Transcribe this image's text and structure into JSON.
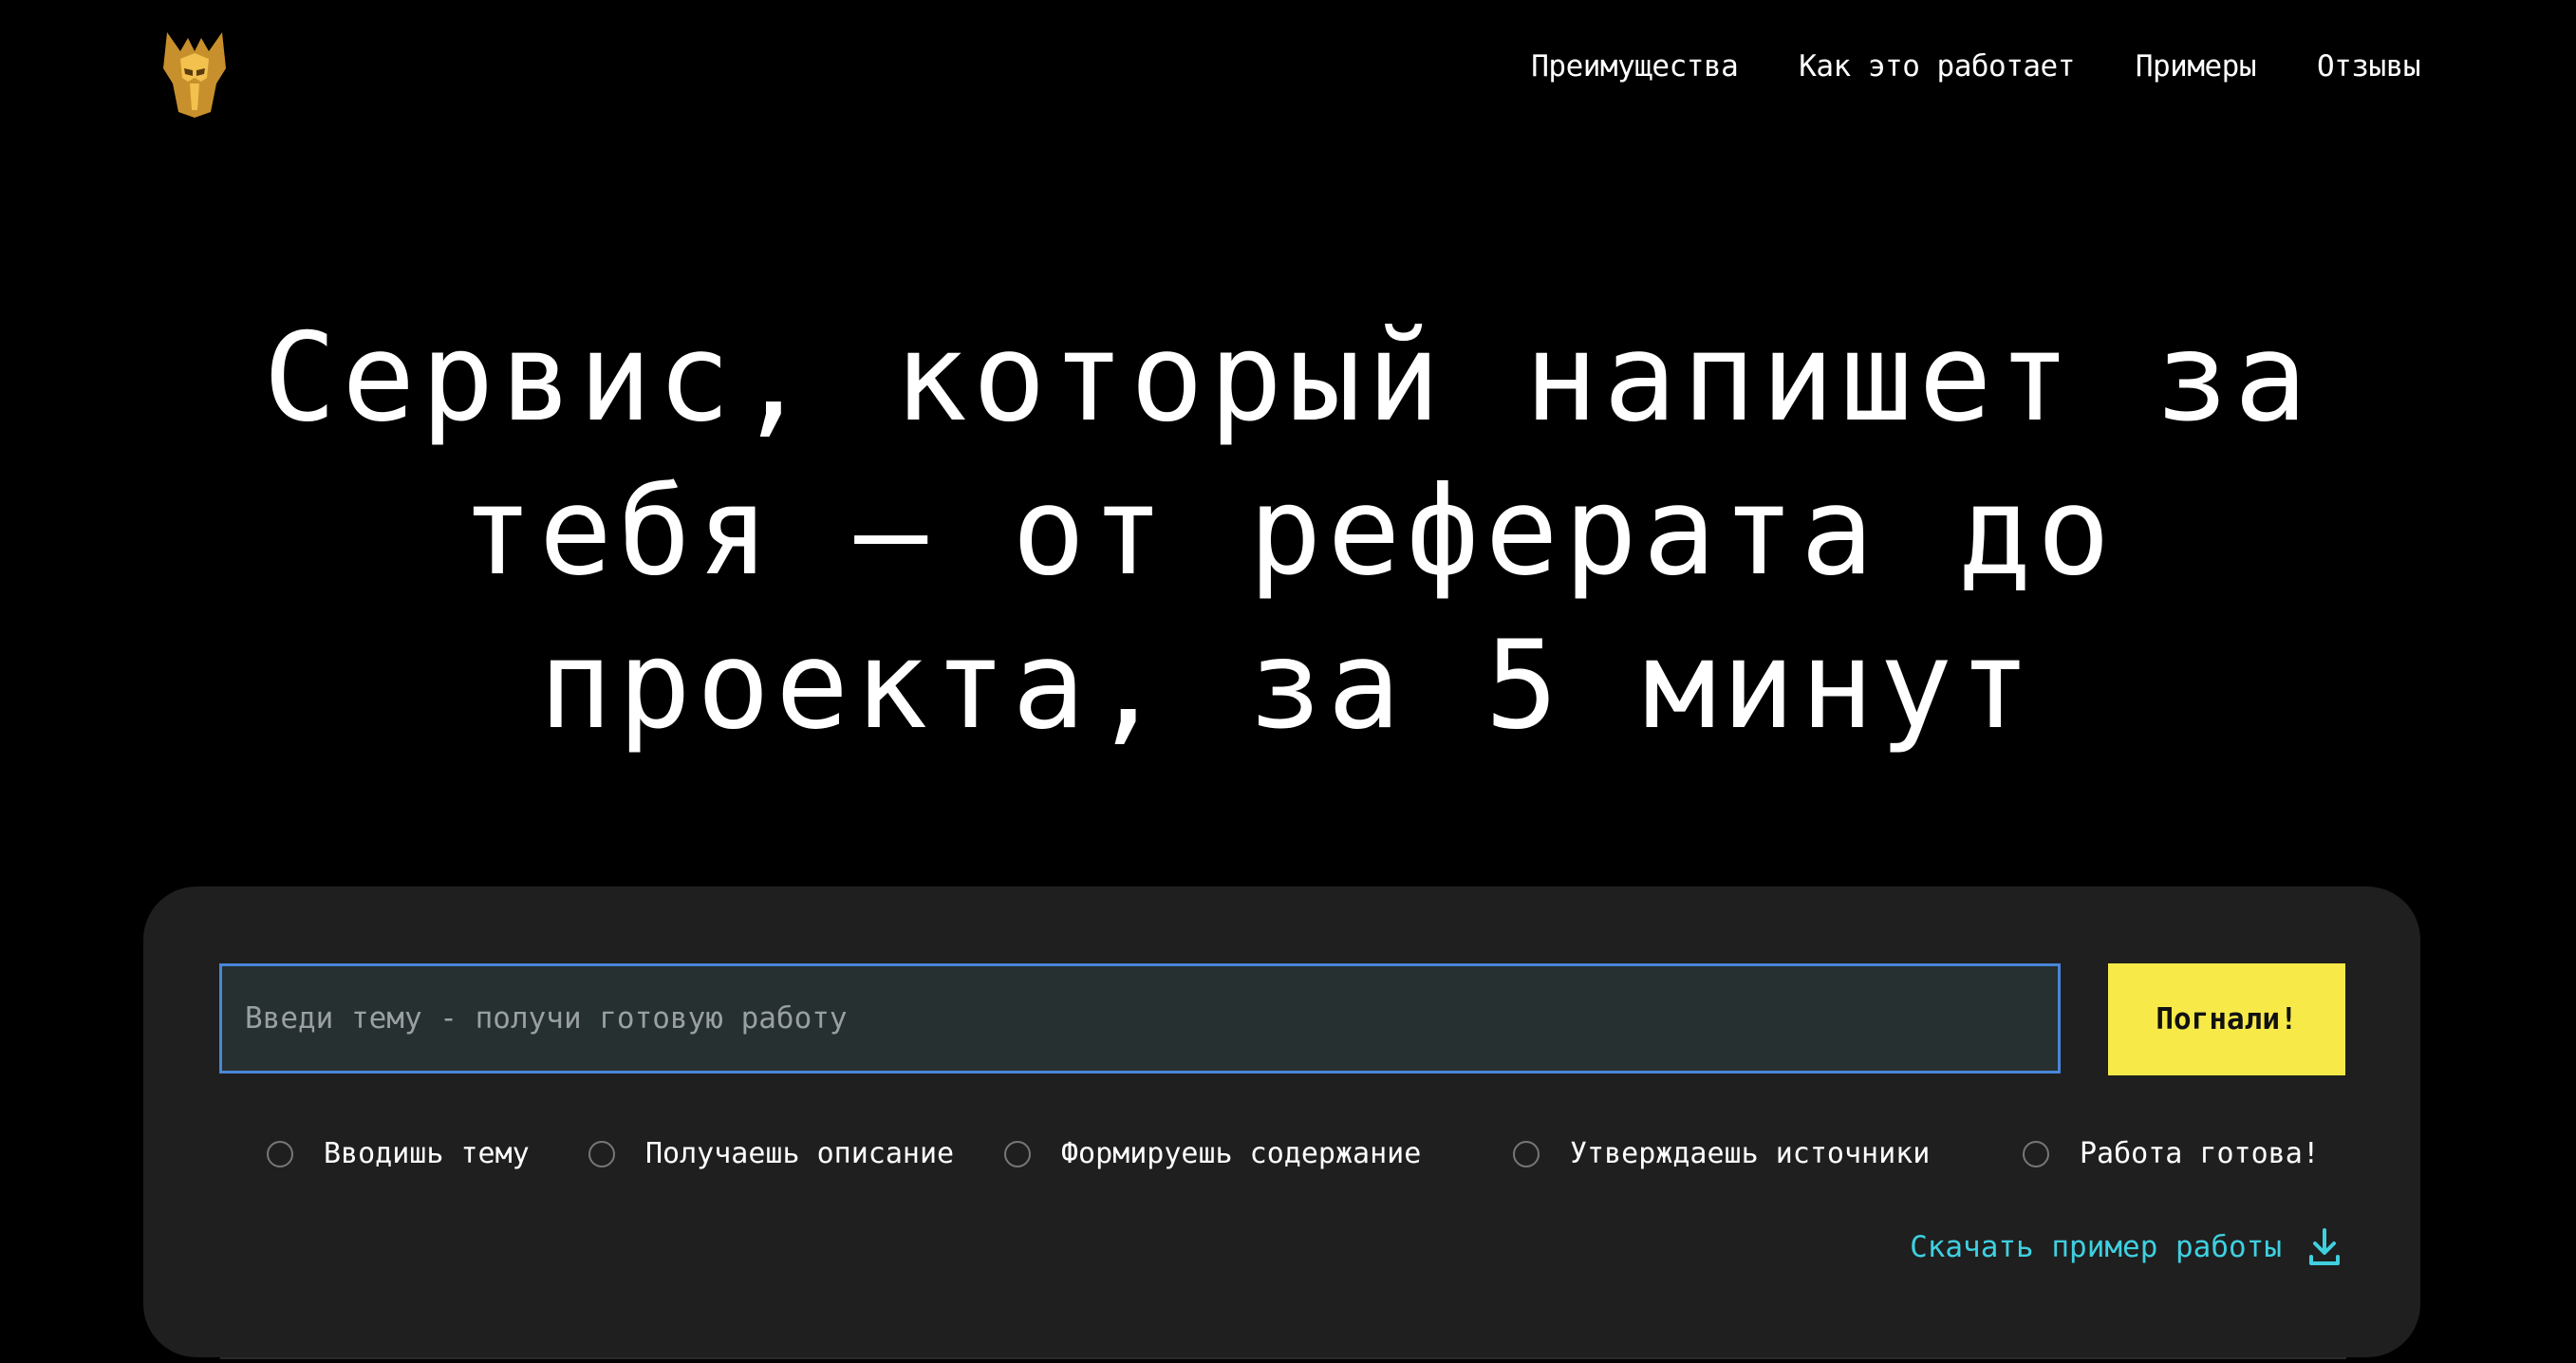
{
  "header": {
    "logo_icon": "warrior-helmet-logo",
    "logo_color": "#d9a637",
    "nav": [
      {
        "label": "Преимущества"
      },
      {
        "label": "Как это работает"
      },
      {
        "label": "Примеры"
      },
      {
        "label": "Отзывы"
      }
    ]
  },
  "hero": {
    "title": "Сервис, который напишет за тебя – от реферата до проекта, за 5 минут"
  },
  "form": {
    "input_placeholder": "Введи тему - получи готовую работу",
    "input_value": "",
    "submit_label": "Погнали!",
    "submit_color": "#f7ea48",
    "steps": [
      {
        "label": "Вводишь тему"
      },
      {
        "label": "Получаешь описание"
      },
      {
        "label": "Формируешь содержание"
      },
      {
        "label": "Утверждаешь источники"
      },
      {
        "label": "Работа готова!"
      }
    ],
    "download_label": "Скачать пример работы",
    "download_icon": "download-icon",
    "link_color": "#3fd0e0"
  }
}
